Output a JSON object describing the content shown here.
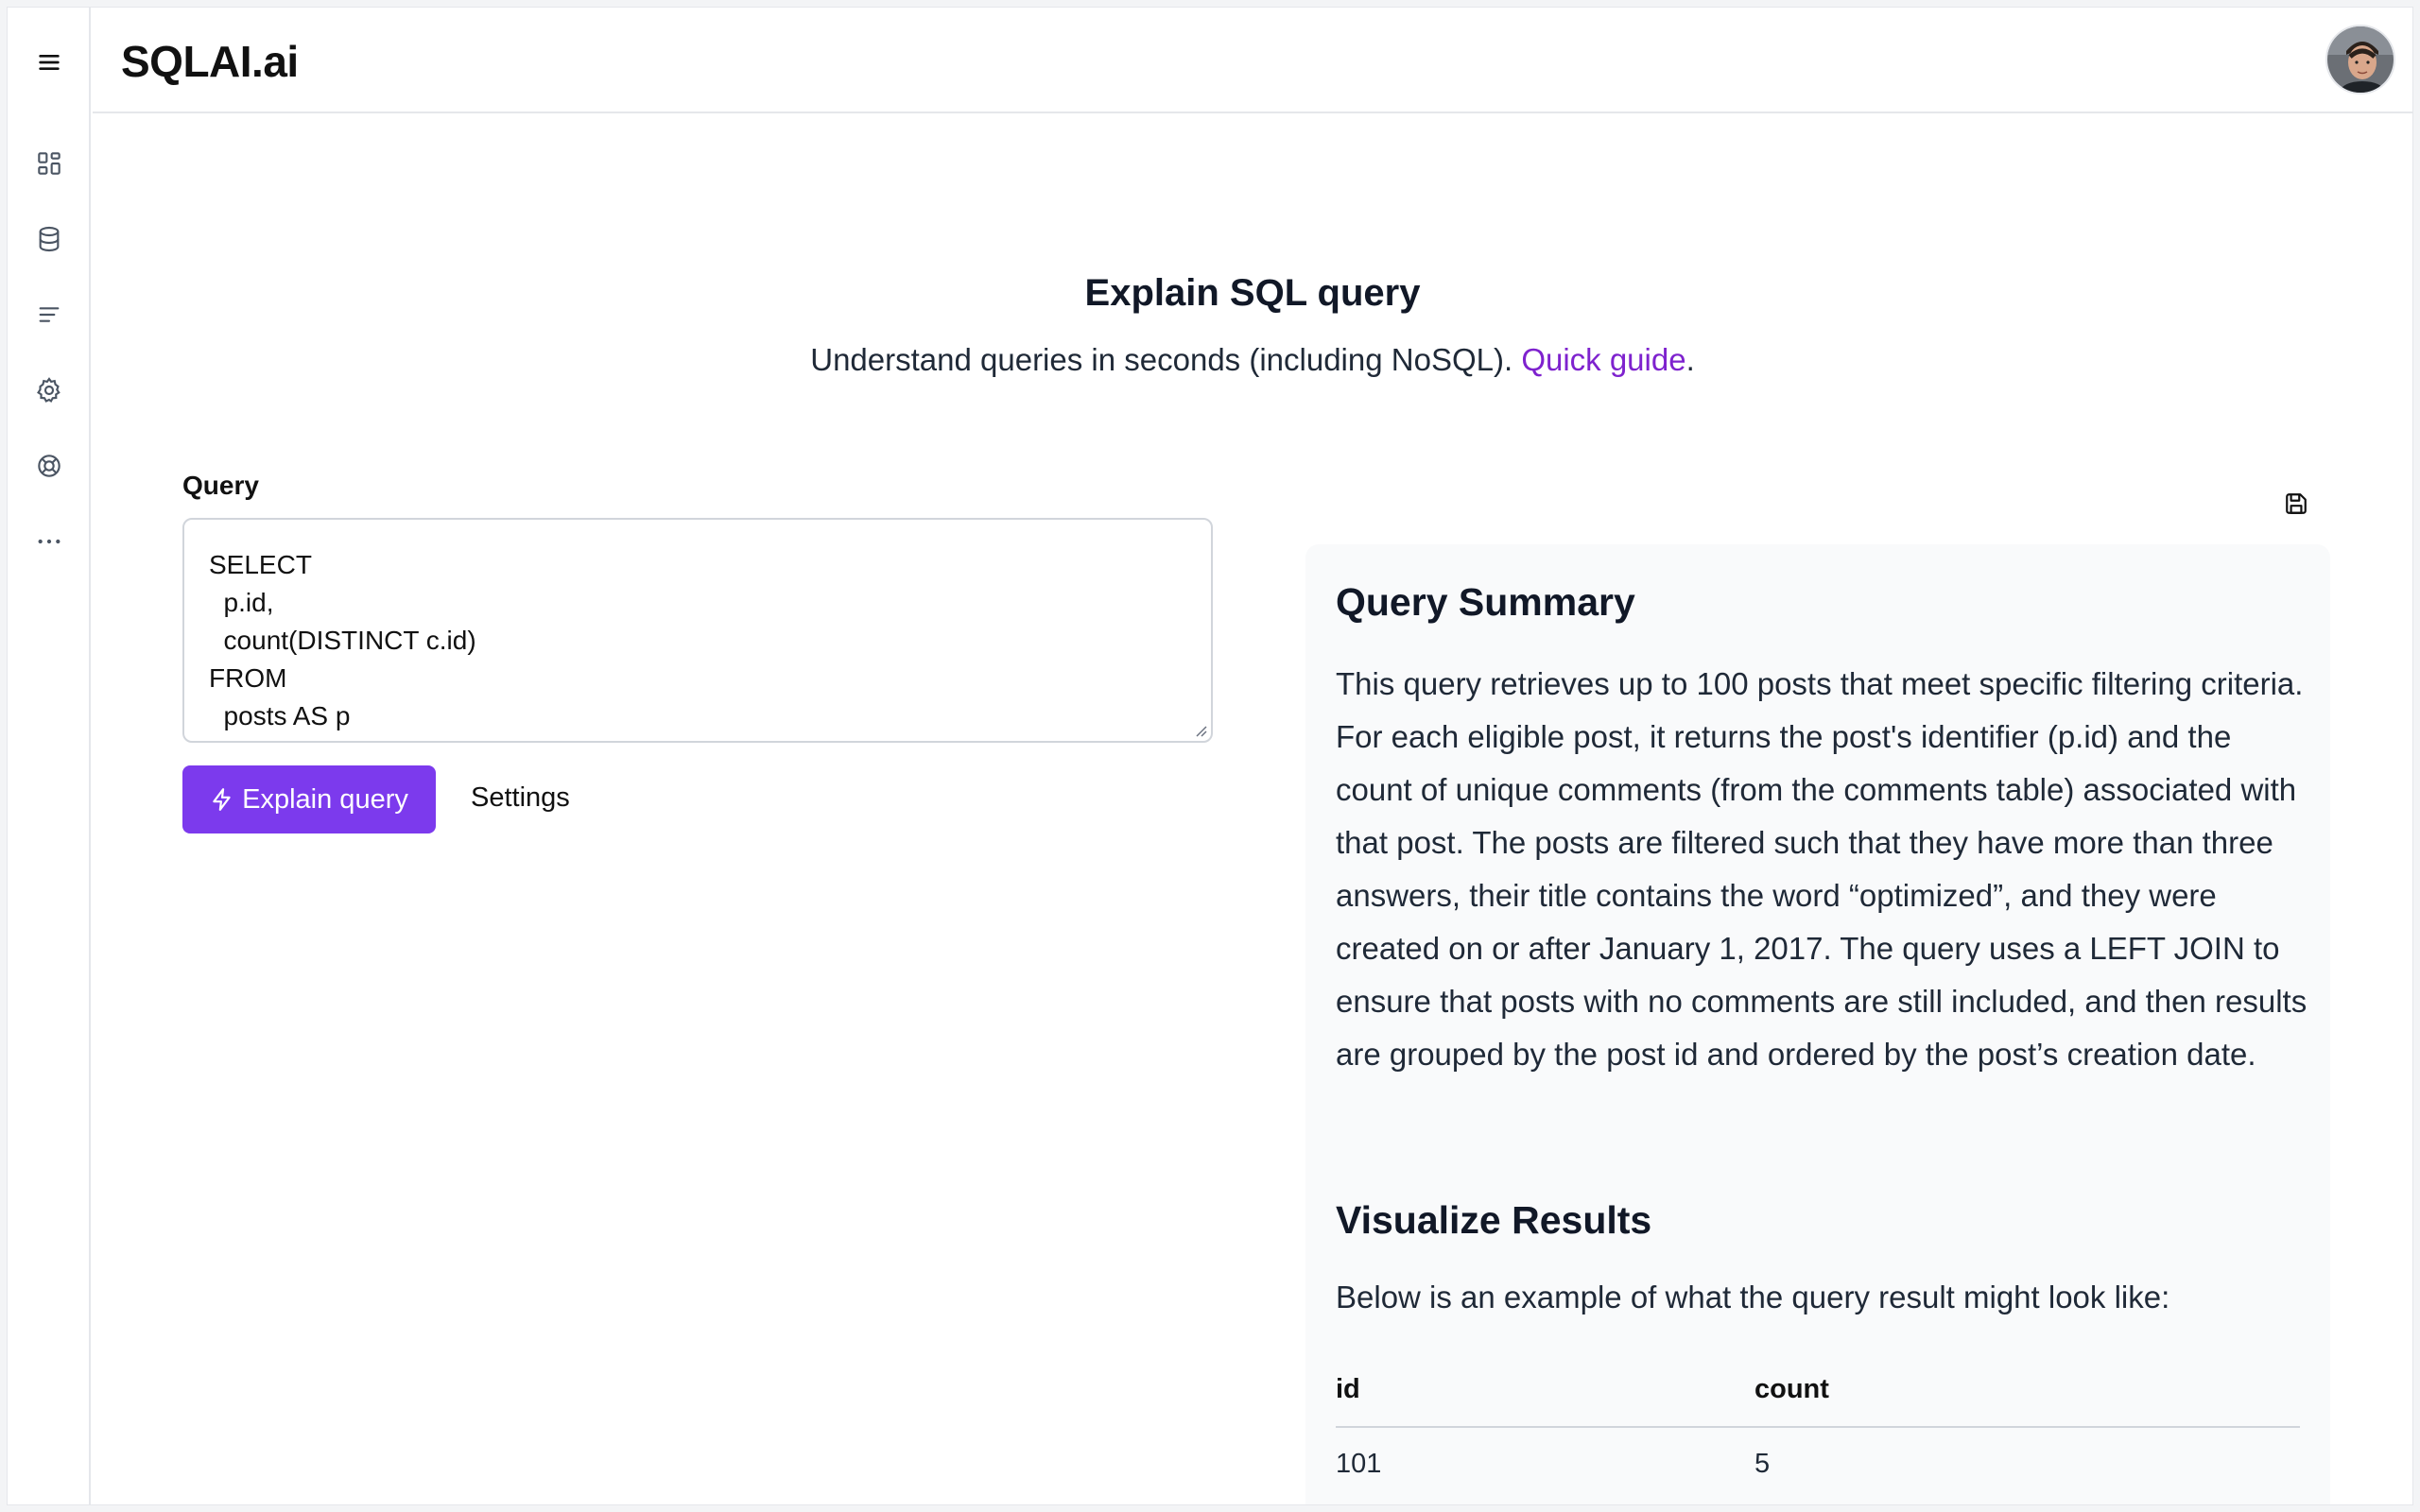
{
  "app": {
    "brand": "SQLAI.ai"
  },
  "sidebar": {
    "items": [
      {
        "name": "menu",
        "icon": "hamburger-menu-icon"
      },
      {
        "name": "dashboard",
        "icon": "dashboard-grid-icon"
      },
      {
        "name": "database",
        "icon": "database-icon"
      },
      {
        "name": "list",
        "icon": "text-lines-icon"
      },
      {
        "name": "settings",
        "icon": "gear-icon"
      },
      {
        "name": "help",
        "icon": "lifebuoy-icon"
      },
      {
        "name": "more",
        "icon": "ellipsis-icon"
      }
    ]
  },
  "hero": {
    "title": "Explain SQL query",
    "subtitle_prefix": "Understand queries in seconds (including NoSQL). ",
    "subtitle_link": "Quick guide",
    "subtitle_suffix": "."
  },
  "query": {
    "label": "Query",
    "code": "SELECT\n  p.id,\n  count(DISTINCT c.id)\nFROM\n  posts AS p\n  LEFT JOIN comments AS c ON c.PostId = p.id",
    "explain_button": "Explain query",
    "settings_button": "Settings"
  },
  "result": {
    "summary_heading": "Query Summary",
    "summary_text": "This query retrieves up to 100 posts that meet specific filtering criteria. For each eligible post, it returns the post's identifier (p.id) and the count of unique comments (from the comments table) associated with that post. The posts are filtered such that they have more than three answers, their title contains the word “optimized”, and they were created on or after January 1, 2017. The query uses a LEFT JOIN to ensure that posts with no comments are still included, and then results are grouped by the post id and ordered by the post’s creation date.",
    "viz_heading": "Visualize Results",
    "viz_text": "Below is an example of what the query result might look like:",
    "table": {
      "headers": [
        "id",
        "count"
      ],
      "rows": [
        [
          "101",
          "5"
        ]
      ]
    }
  },
  "colors": {
    "accent": "#7c3aed",
    "link": "#7e22ce"
  }
}
